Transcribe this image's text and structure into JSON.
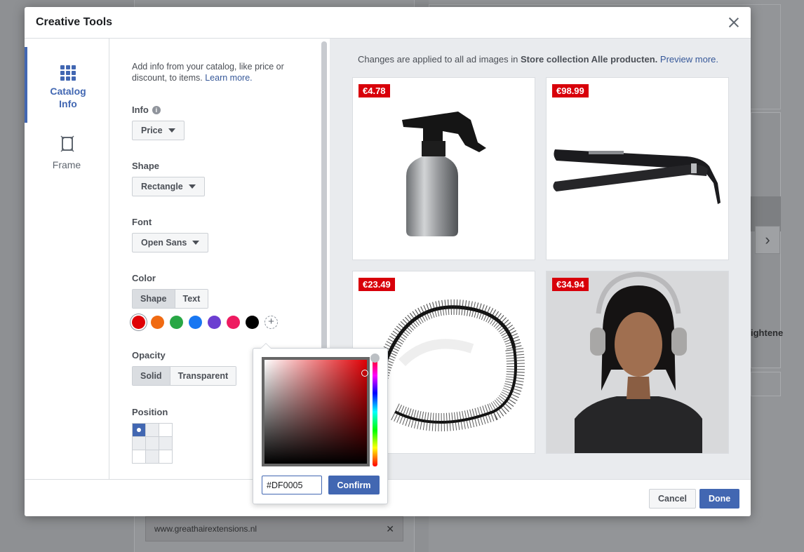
{
  "background": {
    "url_chip": "www.greathairextensions.nl",
    "side_text": "ightene"
  },
  "modal": {
    "title": "Creative Tools"
  },
  "nav": {
    "catalog_info_line1": "Catalog",
    "catalog_info_line2": "Info",
    "frame": "Frame"
  },
  "settings": {
    "intro_text": "Add info from your catalog, like price or discount, to items.",
    "learn_more": "Learn more.",
    "info": {
      "label": "Info",
      "value": "Price"
    },
    "shape": {
      "label": "Shape",
      "value": "Rectangle"
    },
    "font": {
      "label": "Font",
      "value": "Open Sans"
    },
    "color": {
      "label": "Color",
      "tabs": [
        "Shape",
        "Text"
      ],
      "swatches": [
        "#df0005",
        "#f06a12",
        "#28a745",
        "#1877f2",
        "#6c3fd1",
        "#ee1b60",
        "#000000"
      ]
    },
    "opacity": {
      "label": "Opacity",
      "options": [
        "Solid",
        "Transparent"
      ]
    },
    "position": {
      "label": "Position"
    }
  },
  "preview": {
    "note_prefix": "Changes are applied to all ad images in",
    "collection": "Store collection Alle producten.",
    "preview_more": "Preview more.",
    "items": [
      {
        "price": "€4.78",
        "product": "spray-bottle"
      },
      {
        "price": "€98.99",
        "product": "hair-straightener"
      },
      {
        "price": "€23.49",
        "product": "eyelashes"
      },
      {
        "price": "€34.94",
        "product": "model-with-headphones"
      }
    ],
    "tag_color": "#d8000a"
  },
  "picker": {
    "hex_value": "#DF0005",
    "confirm": "Confirm"
  },
  "footer": {
    "cancel": "Cancel",
    "done": "Done"
  }
}
